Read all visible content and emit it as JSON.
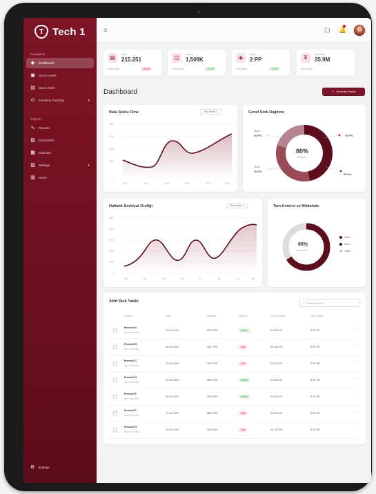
{
  "brand": {
    "name": "Tech 1"
  },
  "sidebar": {
    "head_1": "Navigation",
    "head_2": "Reports",
    "items": [
      {
        "label": "Dashboard",
        "icon": "dashboard-icon",
        "active": true
      },
      {
        "label": "Stock Levels",
        "icon": "box-icon"
      },
      {
        "label": "Stock Alerts",
        "icon": "alert-icon"
      },
      {
        "label": "Inventory Tracking",
        "icon": "tracking-icon",
        "chevron": true
      },
      {
        "label": "Reports",
        "icon": "chart-icon"
      },
      {
        "label": "Documents",
        "icon": "document-icon"
      },
      {
        "label": "Calendar",
        "icon": "calendar-icon"
      },
      {
        "label": "Settings",
        "icon": "settings-icon",
        "chevron": true
      },
      {
        "label": "Users",
        "icon": "users-icon"
      }
    ],
    "footer": "Settings"
  },
  "topbar": {
    "icons": [
      "square-icon",
      "bell-icon",
      "avatar"
    ]
  },
  "stats": [
    {
      "icon": "inventory-icon",
      "label": "Total",
      "value": "215.251",
      "sub": "Last month",
      "badge": "+5.2%",
      "badge_color": "red"
    },
    {
      "icon": "orders-icon",
      "label": "Orders",
      "value": "1,509K",
      "sub": "This month",
      "badge": "+4.1%",
      "badge_color": "green"
    },
    {
      "icon": "shield-icon",
      "label": "Alerts",
      "value": "2 PP",
      "sub": "This week",
      "badge": "+2.3%",
      "badge_color": "green"
    },
    {
      "icon": "revenue-icon",
      "label": "Revenue",
      "value": "35.9M",
      "sub": "Last month",
      "badge": "",
      "badge_color": ""
    }
  ],
  "page_title": "Dashboard",
  "cta": {
    "label": "Generate Report"
  },
  "cards": {
    "flow": {
      "title": "Rafa Stoku Flow",
      "pill": "This month ⇕"
    },
    "donut1": {
      "title": "Genel Stok Dağılımı",
      "center": "80%",
      "center_sub": "Occupied"
    },
    "line2": {
      "title": "Haftalık Sevkiyat Grafiği",
      "pill": "This month ⇕"
    },
    "donut2": {
      "title": "Tam Kontrol ve Müdahale",
      "center": "66%",
      "center_sub": "Controlled"
    },
    "table": {
      "title": "Aktif Stok Takibi",
      "search_placeholder": "Search items"
    }
  },
  "donut1_labels": {
    "tl_name": "Stock",
    "tl_val": "55 P%",
    "bl_name": "Stock",
    "bl_val": "55 P%",
    "tr_val": "51 P%",
    "br_val": "35.8%"
  },
  "donut2_legend": [
    "Stock",
    "Stock",
    "Other"
  ],
  "axis_small": {
    "x": [
      "2017",
      "2018",
      "2019",
      "2020",
      "2021",
      "2022"
    ],
    "y": [
      "4000",
      "3000",
      "2000",
      "1000",
      "0"
    ]
  },
  "axis_small_2": {
    "x": [
      "Mon",
      "Tue",
      "Wed",
      "Thu",
      "Fri",
      "Sat",
      "Sun",
      "Mon"
    ],
    "y": [
      "5000",
      "4000",
      "3000",
      "2000",
      "1000",
      "0"
    ]
  },
  "table": {
    "headers": [
      "Product",
      "Date",
      "Quantity",
      "Status ▾",
      "Current Value",
      "Last Update"
    ],
    "rows": [
      {
        "name": "Product A",
        "sub": "Item code label",
        "date": "23.04.2023",
        "qty": "600 PKB",
        "status": "Active",
        "status_color": "green",
        "value": "€4,250.00",
        "last": "€ 33 PB"
      },
      {
        "name": "Product B",
        "sub": "Item code label",
        "date": "15.04.2023",
        "qty": "445 PKB",
        "status": "Low",
        "status_color": "red",
        "value": "€4,180 PB",
        "last": "€ 33 PB"
      },
      {
        "name": "Product C",
        "sub": "Item code label",
        "date": "12.04.2023",
        "qty": "360 PKB",
        "status": "Low",
        "status_color": "red",
        "value": "€4,225.00",
        "last": "€ 33 PB"
      },
      {
        "name": "Product D",
        "sub": "Item code label",
        "date": "09.04.2023",
        "qty": "380 PKB",
        "status": "Active",
        "status_color": "green",
        "value": "€4,260.00",
        "last": "€ 33 PB"
      },
      {
        "name": "Product E",
        "sub": "Item code label",
        "date": "16.04.2023",
        "qty": "900 PKB",
        "status": "Active",
        "status_color": "green",
        "value": "€4,400.00",
        "last": "€ 33 PB"
      },
      {
        "name": "Product F",
        "sub": "Item code label",
        "date": "17.04.2023",
        "qty": "880 PKB",
        "status": "Low",
        "status_color": "red",
        "value": "€4,200.00",
        "last": "€ 33 PB"
      },
      {
        "name": "Product G",
        "sub": "Item code label",
        "date": "23.04.2023",
        "qty": "340 PKB",
        "status": "Low",
        "status_color": "red",
        "value": "€4,240 PB",
        "last": "€ 33 PB"
      }
    ]
  },
  "colors": {
    "primary": "#7a1325",
    "sidebar": "#6d1020",
    "accent_light": "#f7e3e6"
  }
}
